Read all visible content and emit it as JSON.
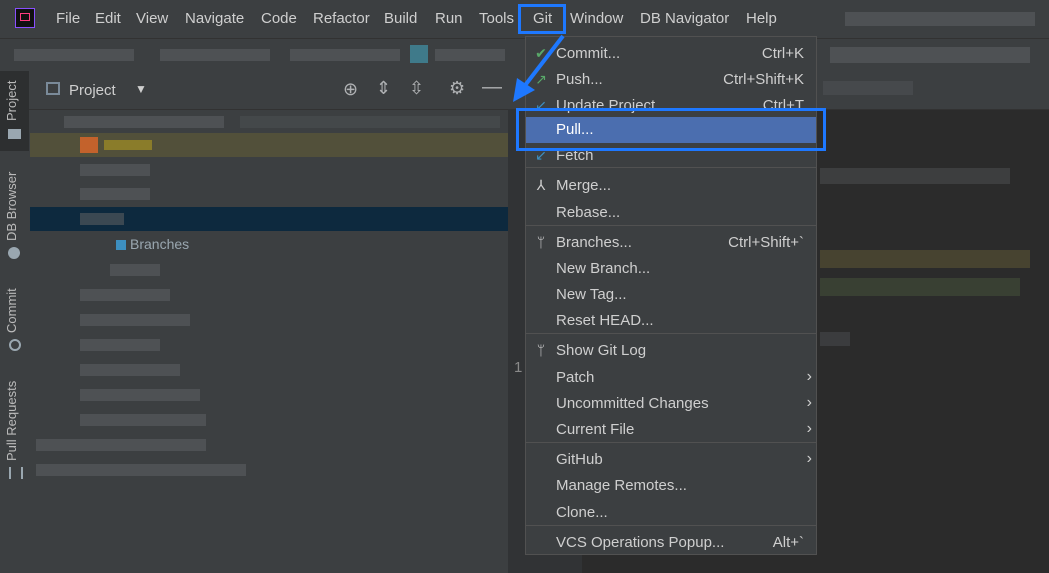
{
  "menubar": {
    "items": [
      "File",
      "Edit",
      "View",
      "Navigate",
      "Code",
      "Refactor",
      "Build",
      "Run",
      "Tools",
      "Git",
      "Window",
      "DB Navigator",
      "Help"
    ]
  },
  "stripe": {
    "tabs": [
      "Project",
      "DB Browser",
      "Commit",
      "Pull Requests"
    ]
  },
  "panel": {
    "title": "Project",
    "tree_items": [
      "Branches"
    ]
  },
  "editor": {
    "line_number": "1"
  },
  "git_menu": {
    "items": [
      {
        "label": "Commit...",
        "shortcut": "Ctrl+K",
        "icon": "check-icon"
      },
      {
        "label": "Push...",
        "shortcut": "Ctrl+Shift+K",
        "icon": "push-arrow-icon"
      },
      {
        "label": "Update Project...",
        "shortcut": "Ctrl+T",
        "icon": "update-arrow-icon"
      },
      {
        "label": "Pull...",
        "shortcut": "",
        "icon": "",
        "selected": true
      },
      {
        "label": "Fetch",
        "shortcut": "",
        "icon": "fetch-arrow-icon"
      },
      {
        "label": "Merge...",
        "shortcut": "",
        "icon": "merge-icon"
      },
      {
        "label": "Rebase...",
        "shortcut": "",
        "icon": ""
      },
      {
        "label": "Branches...",
        "shortcut": "Ctrl+Shift+`",
        "icon": "branch-icon"
      },
      {
        "label": "New Branch...",
        "shortcut": "",
        "icon": ""
      },
      {
        "label": "New Tag...",
        "shortcut": "",
        "icon": ""
      },
      {
        "label": "Reset HEAD...",
        "shortcut": "",
        "icon": ""
      },
      {
        "label": "Show Git Log",
        "shortcut": "",
        "icon": "git-log-icon"
      },
      {
        "label": "Patch",
        "shortcut": "",
        "icon": "",
        "submenu": true
      },
      {
        "label": "Uncommitted Changes",
        "shortcut": "",
        "icon": "",
        "submenu": true
      },
      {
        "label": "Current File",
        "shortcut": "",
        "icon": "",
        "submenu": true
      },
      {
        "label": "GitHub",
        "shortcut": "",
        "icon": "",
        "submenu": true
      },
      {
        "label": "Manage Remotes...",
        "shortcut": "",
        "icon": ""
      },
      {
        "label": "Clone...",
        "shortcut": "",
        "icon": ""
      },
      {
        "label": "VCS Operations Popup...",
        "shortcut": "Alt+`",
        "icon": ""
      }
    ]
  },
  "colors": {
    "accent_highlight": "#1e78ff",
    "selection": "#4b6eaf",
    "menu_bg": "#3c3f41",
    "editor_bg": "#2b2b2b"
  }
}
